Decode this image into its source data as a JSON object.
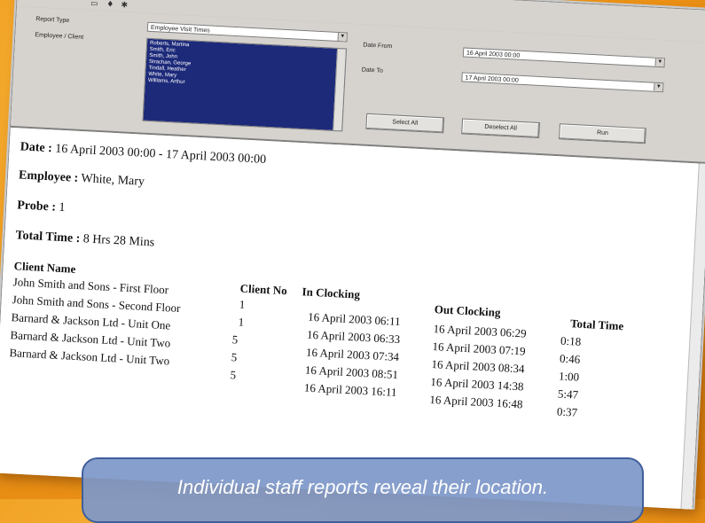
{
  "filters": {
    "report_type_label": "Report Type",
    "report_type_value": "Employee Visit Times",
    "employee_client_label": "Employee / Client",
    "employees": [
      "Roberts, Martina",
      "Smith, Eric",
      "Smith, John",
      "Strachan, George",
      "Tindall, Heather",
      "White, Mary",
      "Williams, Arthur"
    ],
    "date_from_label": "Date From",
    "date_from_value": "16   April   2003 00:00",
    "date_to_label": "Date To",
    "date_to_value": "17   April   2003 00:00",
    "select_all": "Select All",
    "deselect_all": "Deselect All",
    "run": "Run"
  },
  "report": {
    "date_label": "Date :",
    "date_value": "16 April 2003 00:00 - 17 April 2003 00:00",
    "employee_label": "Employee :",
    "employee_value": "White, Mary",
    "probe_label": "Probe :",
    "probe_value": "1",
    "total_label": "Total Time :",
    "total_value": "8 Hrs 28 Mins",
    "headers": {
      "client_name": "Client Name",
      "client_no": "Client No",
      "in_clocking": "In Clocking",
      "out_clocking": "Out Clocking",
      "total_time": "Total Time"
    },
    "rows": [
      {
        "client": "John Smith and Sons - First Floor",
        "no": "1",
        "in": "16 April 2003 06:11",
        "out": "16 April 2003 06:29",
        "total": "0:18"
      },
      {
        "client": "John Smith and Sons - Second Floor",
        "no": "1",
        "in": "16 April 2003 06:33",
        "out": "16 April 2003 07:19",
        "total": "0:46"
      },
      {
        "client": "Barnard & Jackson Ltd - Unit One",
        "no": "5",
        "in": "16 April 2003 07:34",
        "out": "16 April 2003 08:34",
        "total": "1:00"
      },
      {
        "client": "Barnard & Jackson Ltd - Unit Two",
        "no": "5",
        "in": "16 April 2003 08:51",
        "out": "16 April 2003 14:38",
        "total": "5:47"
      },
      {
        "client": "Barnard & Jackson Ltd - Unit Two",
        "no": "5",
        "in": "16 April 2003 16:11",
        "out": "16 April 2003 16:48",
        "total": "0:37"
      }
    ]
  },
  "caption": "Individual staff reports reveal their location."
}
